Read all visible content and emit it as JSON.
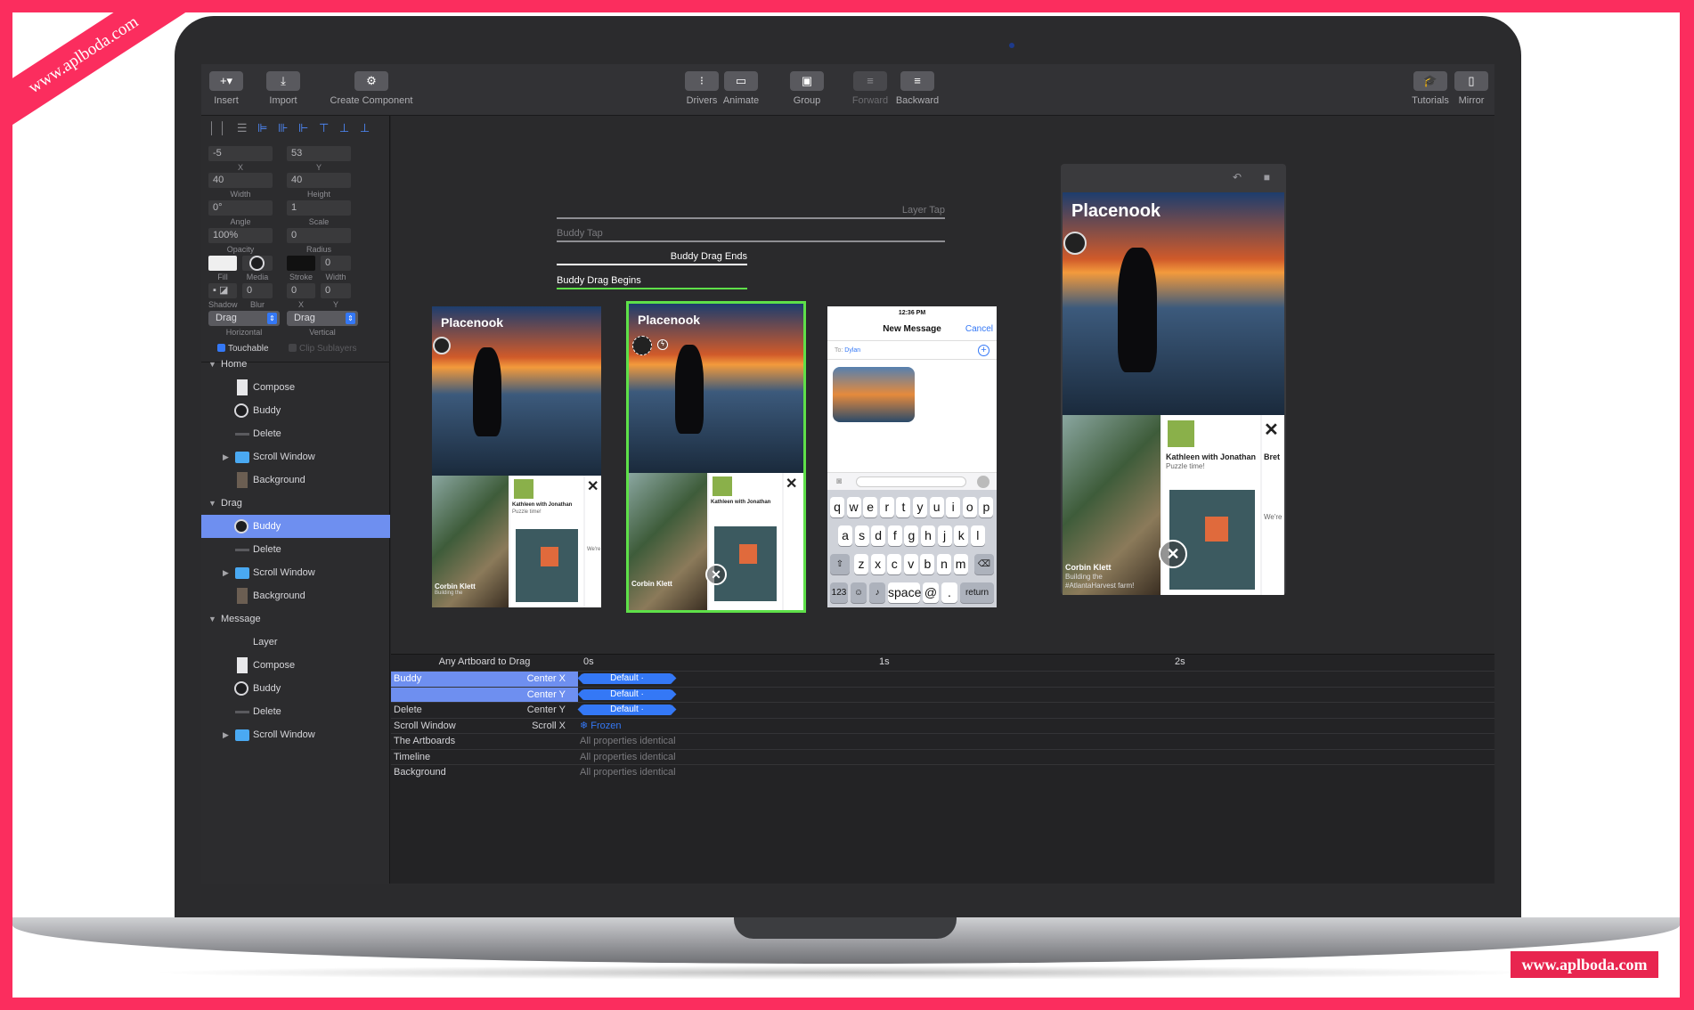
{
  "watermark": {
    "ribbon": "www.aplboda.com",
    "badge": "www.aplboda.com"
  },
  "toolbar": {
    "insert": "Insert",
    "import": "Import",
    "create_component": "Create Component",
    "drivers": "Drivers",
    "animate": "Animate",
    "group": "Group",
    "forward": "Forward",
    "backward": "Backward",
    "tutorials": "Tutorials",
    "mirror": "Mirror"
  },
  "inspector": {
    "x": "-5",
    "y": "53",
    "x_label": "X",
    "y_label": "Y",
    "width": "40",
    "height": "40",
    "width_label": "Width",
    "height_label": "Height",
    "angle": "0°",
    "scale": "1",
    "angle_label": "Angle",
    "scale_label": "Scale",
    "opacity": "100%",
    "radius": "0",
    "opacity_label": "Opacity",
    "radius_label": "Radius",
    "fill_label": "Fill",
    "media_label": "Media",
    "stroke_label": "Stroke",
    "stroke_width": "0",
    "stroke_width_label": "Width",
    "shadow_label": "Shadow",
    "blur": "0",
    "blur_label": "Blur",
    "shadow_x": "0",
    "shadow_x_label": "X",
    "shadow_y": "0",
    "shadow_y_label": "Y",
    "horizontal": "Drag",
    "horizontal_label": "Horizontal",
    "vertical": "Drag",
    "vertical_label": "Vertical",
    "touchable": "Touchable",
    "clip_sublayers": "Clip Sublayers"
  },
  "layers": [
    {
      "label": "Home",
      "type": "group"
    },
    {
      "label": "Compose",
      "type": "doc"
    },
    {
      "label": "Buddy",
      "type": "avatar"
    },
    {
      "label": "Delete",
      "type": "line"
    },
    {
      "label": "Scroll Window",
      "type": "folder"
    },
    {
      "label": "Background",
      "type": "bg"
    },
    {
      "label": "Drag",
      "type": "group"
    },
    {
      "label": "Buddy",
      "type": "avatar",
      "selected": true
    },
    {
      "label": "Delete",
      "type": "line"
    },
    {
      "label": "Scroll Window",
      "type": "folder"
    },
    {
      "label": "Background",
      "type": "bg"
    },
    {
      "label": "Message",
      "type": "group"
    },
    {
      "label": "Layer",
      "type": "plain"
    },
    {
      "label": "Compose",
      "type": "doc"
    },
    {
      "label": "Buddy",
      "type": "avatar"
    },
    {
      "label": "Delete",
      "type": "line"
    },
    {
      "label": "Scroll Window",
      "type": "folder"
    }
  ],
  "canvas": {
    "layer_tap": "Layer Tap",
    "buddy_tap": "Buddy Tap",
    "buddy_drag_ends": "Buddy Drag Ends",
    "buddy_drag_begins": "Buddy Drag Begins",
    "brand": "Placenook",
    "card_title": "Kathleen with Jonathan",
    "card_sub": "Puzzle time!",
    "card_author": "Corbin Klett",
    "card_author_sub": "Building the",
    "card_author_sub2": "#AtlantaHarvest farm!",
    "card_partial": "Bret",
    "card_partial_sub": "We're",
    "message": {
      "time": "12:36 PM",
      "title": "New Message",
      "cancel": "Cancel",
      "to_label": "To:",
      "to_value": "Dylan",
      "row1": [
        "q",
        "w",
        "e",
        "r",
        "t",
        "y",
        "u",
        "i",
        "o",
        "p"
      ],
      "row2": [
        "a",
        "s",
        "d",
        "f",
        "g",
        "h",
        "j",
        "k",
        "l"
      ],
      "row3": [
        "z",
        "x",
        "c",
        "v",
        "b",
        "n",
        "m"
      ],
      "num": "123",
      "space": "space",
      "at": "@",
      "dot": ".",
      "return": "return"
    }
  },
  "timeline": {
    "title": "Any Artboard to Drag",
    "ticks": [
      "0s",
      "1s",
      "2s"
    ],
    "rows": [
      {
        "name": "Buddy",
        "prop": "Center X",
        "state": "Default ·",
        "kind": "pill",
        "hl": true
      },
      {
        "name": "",
        "prop": "Center Y",
        "state": "Default ·",
        "kind": "pill",
        "hl": true
      },
      {
        "name": "Delete",
        "prop": "Center Y",
        "state": "Default ·",
        "kind": "pill"
      },
      {
        "name": "Scroll Window",
        "prop": "Scroll X",
        "state": "Frozen",
        "kind": "frozen"
      },
      {
        "name": "The Artboards",
        "prop": "",
        "state": "All properties identical",
        "kind": "text"
      },
      {
        "name": "Timeline",
        "prop": "",
        "state": "All properties identical",
        "kind": "text"
      },
      {
        "name": "Background",
        "prop": "",
        "state": "All properties identical",
        "kind": "text"
      }
    ]
  },
  "colors": {
    "accent": "#3478f6",
    "selection": "#6e8ff0",
    "highlight_border": "#5ee049",
    "page": "#fb2d5e"
  }
}
